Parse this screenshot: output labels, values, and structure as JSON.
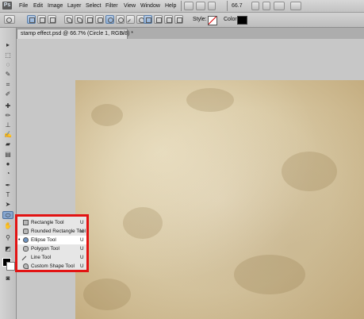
{
  "app": {
    "logo": "Ps"
  },
  "menubar": {
    "items": [
      "File",
      "Edit",
      "Image",
      "Layer",
      "Select",
      "Filter",
      "View",
      "Window",
      "Help"
    ],
    "zoom": "66.7"
  },
  "options_bar": {
    "style_label": "Style:",
    "color_label": "Color:",
    "color_value": "#000000"
  },
  "document": {
    "tab_title": "stamp effect.psd @ 66.7% (Circle 1, RGB/8) *",
    "close_glyph": "×"
  },
  "flyout": {
    "items": [
      {
        "label": "Rectangle Tool",
        "shortcut": "U",
        "icon": "rectangle-icon",
        "selected": false
      },
      {
        "label": "Rounded Rectangle Tool",
        "shortcut": "U",
        "icon": "rounded-rectangle-icon",
        "selected": false
      },
      {
        "label": "Ellipse Tool",
        "shortcut": "U",
        "icon": "ellipse-icon",
        "selected": true
      },
      {
        "label": "Polygon Tool",
        "shortcut": "U",
        "icon": "polygon-icon",
        "selected": false
      },
      {
        "label": "Line Tool",
        "shortcut": "U",
        "icon": "line-icon",
        "selected": false
      },
      {
        "label": "Custom Shape Tool",
        "shortcut": "U",
        "icon": "custom-shape-icon",
        "selected": false
      }
    ],
    "bullet": "•",
    "highlight_color": "#e21313"
  },
  "colors": {
    "foreground": "#000000",
    "background": "#ffffff",
    "accent": "#86a6cf"
  }
}
